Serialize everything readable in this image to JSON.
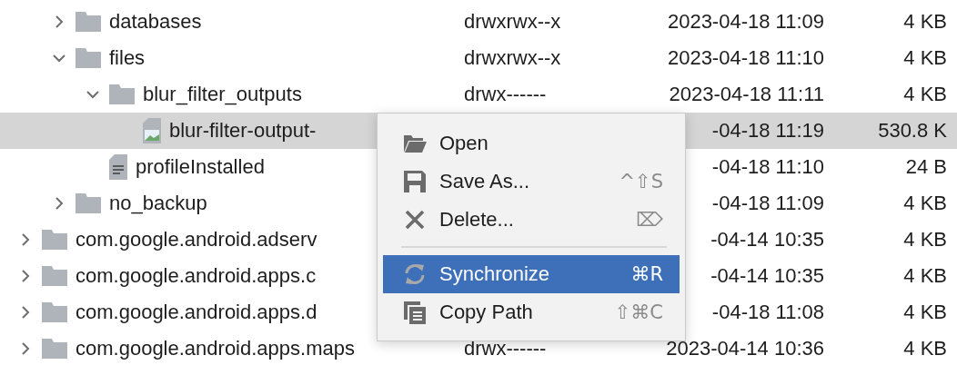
{
  "tree": [
    {
      "children": [
        {
          "name": "databases",
          "kind": "folder",
          "expanded": false,
          "selected": false,
          "permissions": "drwxrwx--x",
          "date": "2023-04-18 11:09",
          "size": "4 KB"
        },
        {
          "name": "files",
          "kind": "folder",
          "expanded": true,
          "selected": false,
          "permissions": "drwxrwx--x",
          "date": "2023-04-18 11:10",
          "size": "4 KB",
          "children": [
            {
              "name": "blur_filter_outputs",
              "kind": "folder",
              "expanded": true,
              "selected": false,
              "permissions": "drwx------",
              "date": "2023-04-18 11:11",
              "size": "4 KB",
              "children": [
                {
                  "name": "blur-filter-output-",
                  "kind": "image",
                  "selected": true,
                  "date": "-04-18 11:19",
                  "size": "530.8 K"
                }
              ]
            },
            {
              "name": "profileInstalled",
              "kind": "text",
              "selected": false,
              "date": "-04-18 11:10",
              "size": "24 B"
            }
          ]
        },
        {
          "name": "no_backup",
          "kind": "folder",
          "expanded": false,
          "selected": false,
          "date": "-04-18 11:09",
          "size": "4 KB"
        }
      ]
    },
    {
      "name": "com.google.android.adserv",
      "kind": "folder",
      "expanded": false,
      "selected": false,
      "date": "-04-14 10:35",
      "size": "4 KB"
    },
    {
      "name": "com.google.android.apps.c",
      "kind": "folder",
      "expanded": false,
      "selected": false,
      "date": "-04-14 10:35",
      "size": "4 KB"
    },
    {
      "name": "com.google.android.apps.d",
      "kind": "folder",
      "expanded": false,
      "selected": false,
      "date": "-04-18 11:08",
      "size": "4 KB"
    },
    {
      "name": "com.google.android.apps.maps",
      "kind": "folder",
      "expanded": false,
      "selected": false,
      "permissions": "drwx------",
      "date": "2023-04-14 10:36",
      "size": "4 KB"
    }
  ],
  "context_menu": [
    {
      "kind": "item",
      "label": "Open",
      "selected": false
    },
    {
      "kind": "item",
      "label": "Save As...",
      "shortcut": "^⇧S",
      "selected": false
    },
    {
      "kind": "item",
      "label": "Delete...",
      "shortcut": "⌦",
      "selected": false
    },
    {
      "kind": "separator"
    },
    {
      "kind": "item",
      "label": "Synchronize",
      "shortcut": "⌘R",
      "selected": true
    },
    {
      "kind": "item",
      "label": "Copy Path",
      "shortcut": "⇧⌘C",
      "selected": false
    }
  ]
}
